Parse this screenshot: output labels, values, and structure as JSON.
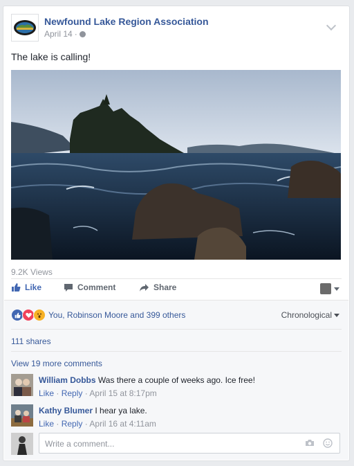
{
  "post": {
    "page_name": "Newfound Lake Region Association",
    "date": "April 14",
    "dot": "·",
    "privacy_icon": "globe-icon",
    "text": "The lake is calling!",
    "views": "9.2K Views"
  },
  "actions": {
    "like": "Like",
    "comment": "Comment",
    "share": "Share"
  },
  "reactions": {
    "names": "You, Robinson Moore and 399 others",
    "sort_label": "Chronological",
    "shares": "111 shares",
    "more_comments": "View 19 more comments"
  },
  "comments": [
    {
      "name": "William Dobbs",
      "text": "Was there a couple of weeks ago. Ice free!",
      "like": "Like",
      "reply": "Reply",
      "time": "April 15 at 8:17pm"
    },
    {
      "name": "Kathy Blumer",
      "text": "I hear ya lake.",
      "like": "Like",
      "reply": "Reply",
      "time": "April 16 at 4:11am"
    }
  ],
  "composer": {
    "placeholder": "Write a comment..."
  },
  "colors": {
    "link": "#365899",
    "accent": "#4267b2",
    "muted": "#90949c"
  }
}
